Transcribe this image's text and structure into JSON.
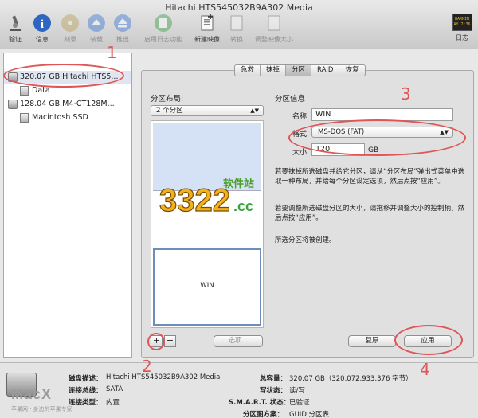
{
  "window": {
    "title": "Hitachi HTS545032B9A302 Media"
  },
  "toolbar": {
    "items": [
      {
        "label": "验证",
        "icon": "microscope-icon",
        "enabled": true
      },
      {
        "label": "信息",
        "icon": "info-icon",
        "enabled": true
      },
      {
        "label": "刻录",
        "icon": "burn-disc-icon",
        "enabled": false
      },
      {
        "label": "装载",
        "icon": "mount-icon",
        "enabled": false
      },
      {
        "label": "推出",
        "icon": "eject-icon",
        "enabled": false
      },
      {
        "label": "启用日志功能",
        "icon": "journal-icon",
        "enabled": false
      },
      {
        "label": "新建映像",
        "icon": "new-image-icon",
        "enabled": true
      },
      {
        "label": "转换",
        "icon": "convert-icon",
        "enabled": false
      },
      {
        "label": "调整映像大小",
        "icon": "resize-image-icon",
        "enabled": false
      }
    ],
    "log": {
      "label": "日志",
      "badge_line1": "WARNIN",
      "badge_line2": "AY 7:36"
    }
  },
  "sidebar": {
    "items": [
      {
        "label": "320.07 GB Hitachi HTS5...",
        "kind": "disk"
      },
      {
        "label": "Data",
        "kind": "volume"
      },
      {
        "label": "128.04 GB M4-CT128M...",
        "kind": "disk"
      },
      {
        "label": "Macintosh SSD",
        "kind": "volume"
      }
    ]
  },
  "tabs": [
    {
      "label": "急救",
      "active": false
    },
    {
      "label": "抹掉",
      "active": false
    },
    {
      "label": "分区",
      "active": true
    },
    {
      "label": "RAID",
      "active": false
    },
    {
      "label": "恢复",
      "active": false
    }
  ],
  "partition": {
    "layout_label": "分区布局:",
    "layout_value": "2 个分区",
    "info_label": "分区信息",
    "selected_partition": "WIN",
    "add_label": "+",
    "remove_label": "−",
    "options_label": "选项..."
  },
  "info": {
    "name_label": "名称:",
    "name_value": "WIN",
    "format_label": "格式:",
    "format_value": "MS-DOS (FAT)",
    "size_label": "大小:",
    "size_value": "120",
    "size_unit": "GB",
    "help1": "若要抹掉所选磁盘并给它分区，请从“分区布局”弹出式菜单中选取一种布局，并给每个分区设定选项，然后点按“应用”。",
    "help2": "若要调整所选磁盘分区的大小，请拖移并调整大小的控制柄，然后点按“应用”。",
    "help3": "所选分区将被创建。"
  },
  "buttons": {
    "revert": "复原",
    "apply": "应用"
  },
  "disk_info": {
    "desc_label": "磁盘描述：",
    "desc_value": "Hitachi HTS545032B9A302 Media",
    "bus_label": "连接总线：",
    "bus_value": "SATA",
    "conn_label": "连接类型：",
    "conn_value": "内置",
    "capacity_label": "总容量：",
    "capacity_value": "320.07 GB（320,072,933,376 字节）",
    "write_label": "写状态：",
    "write_value": "读/写",
    "smart_label": "S.M.A.R.T. 状态：",
    "smart_value": "已验证",
    "scheme_label": "分区图方案：",
    "scheme_value": "GUID 分区表"
  },
  "annotations": [
    "1",
    "2",
    "3",
    "4"
  ],
  "watermark": {
    "logo_digits": "3322",
    "logo_suffix": ".cc",
    "logo_tag": "软件站",
    "bottom_brand": "MacX",
    "bottom_sub": "苹果网 · 身边的苹果专家"
  },
  "colors": {
    "annotation": "#e05555",
    "selected_partition_border": "#6e8db9",
    "partition_free": "#d5e1f5"
  }
}
